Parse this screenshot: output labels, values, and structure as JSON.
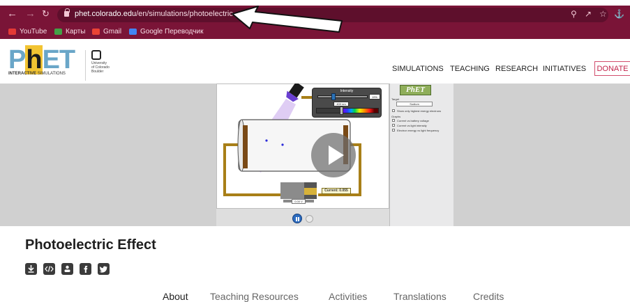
{
  "browser": {
    "url_host": "phet.colorado.edu",
    "url_path": "/en/simulations/photoelectric",
    "bookmarks": [
      {
        "label": "YouTube",
        "color": "#e53935"
      },
      {
        "label": "Карты",
        "color": "#43a047"
      },
      {
        "label": "Gmail",
        "color": "#ea4335"
      },
      {
        "label": "Google Переводчик",
        "color": "#4285f4"
      }
    ]
  },
  "header": {
    "logo_text": "PhET",
    "logo_subtitle_bold": "INTERACTIVE",
    "logo_subtitle": "SIMULATIONS",
    "university_lines": [
      "University",
      "of Colorado",
      "Boulder"
    ],
    "nav": [
      "SIMULATIONS",
      "TEACHING",
      "RESEARCH",
      "INITIATIVES"
    ],
    "donate": "DONATE"
  },
  "sim": {
    "intensity_label": "Intensity",
    "intensity_value": "19%",
    "wavelength_value": "400 nm",
    "current_label": "Current:",
    "current_value": "0.055",
    "voltage_value": "0.00 V",
    "controls": {
      "logo": "PhET",
      "target_label": "Target",
      "target_value": "Sodium",
      "show_highest_energy": "Show only highest energy electrons",
      "graphs_label": "Graphs",
      "graph_options": [
        "Current vs battery voltage",
        "Current vs light intensity",
        "Electron energy vs light frequency"
      ]
    }
  },
  "page": {
    "title": "Photoelectric Effect",
    "share_icons": [
      "download-icon",
      "embed-icon",
      "person-icon",
      "facebook-icon",
      "twitter-icon"
    ],
    "tabs": [
      "About",
      "Teaching Resources",
      "Activities",
      "Translations",
      "Credits"
    ]
  }
}
